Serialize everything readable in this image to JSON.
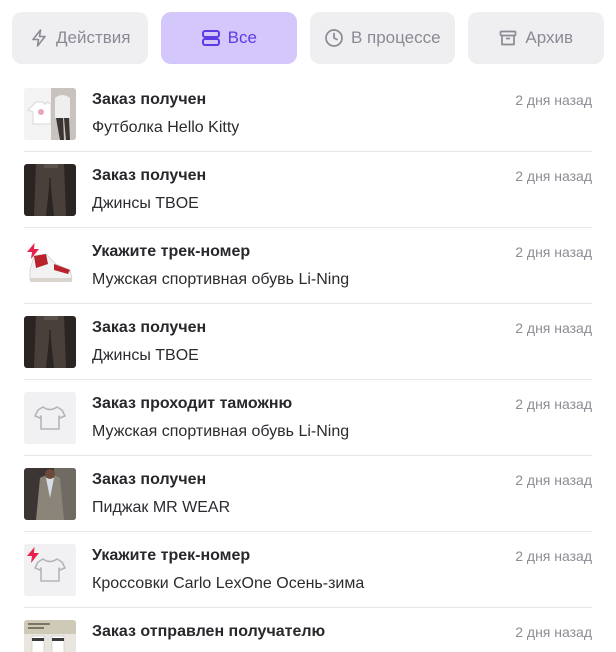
{
  "tabs": [
    {
      "label": "Действия",
      "icon": "lightning-icon",
      "active": false
    },
    {
      "label": "Все",
      "icon": "stack-icon",
      "active": true
    },
    {
      "label": "В процессе",
      "icon": "clock-icon",
      "active": false
    },
    {
      "label": "Архив",
      "icon": "archive-box-icon",
      "active": false
    }
  ],
  "colors": {
    "accent": "#5b3ce6",
    "accent_bg": "#d4c7fb",
    "tab_bg": "#efeff2",
    "alert": "#e8224d"
  },
  "notifications": [
    {
      "title": "Заказ получен",
      "item": "Футболка Hello Kitty",
      "time": "2 дня назад",
      "thumb": "tshirt-photo",
      "alert": false
    },
    {
      "title": "Заказ получен",
      "item": "Джинсы TBOE",
      "time": "2 дня назад",
      "thumb": "jeans-photo",
      "alert": false
    },
    {
      "title": "Укажите трек-номер",
      "item": "Мужская спортивная обувь Li-Ning",
      "time": "2 дня назад",
      "thumb": "sneaker-photo",
      "alert": true
    },
    {
      "title": "Заказ получен",
      "item": "Джинсы TBOE",
      "time": "2 дня назад",
      "thumb": "jeans-photo",
      "alert": false
    },
    {
      "title": "Заказ проходит таможню",
      "item": "Мужская спортивная обувь Li-Ning",
      "time": "2 дня назад",
      "thumb": "placeholder-shirt",
      "alert": false
    },
    {
      "title": "Заказ получен",
      "item": "Пиджак MR WEAR",
      "time": "2 дня назад",
      "thumb": "jacket-photo",
      "alert": false
    },
    {
      "title": "Укажите трек-номер",
      "item": "Кроссовки Carlo LexOne Осень-зима",
      "time": "2 дня назад",
      "thumb": "placeholder-shirt",
      "alert": true
    },
    {
      "title": "Заказ отправлен получателю",
      "item": "",
      "time": "2 дня назад",
      "thumb": "socks-photo",
      "alert": false
    }
  ]
}
